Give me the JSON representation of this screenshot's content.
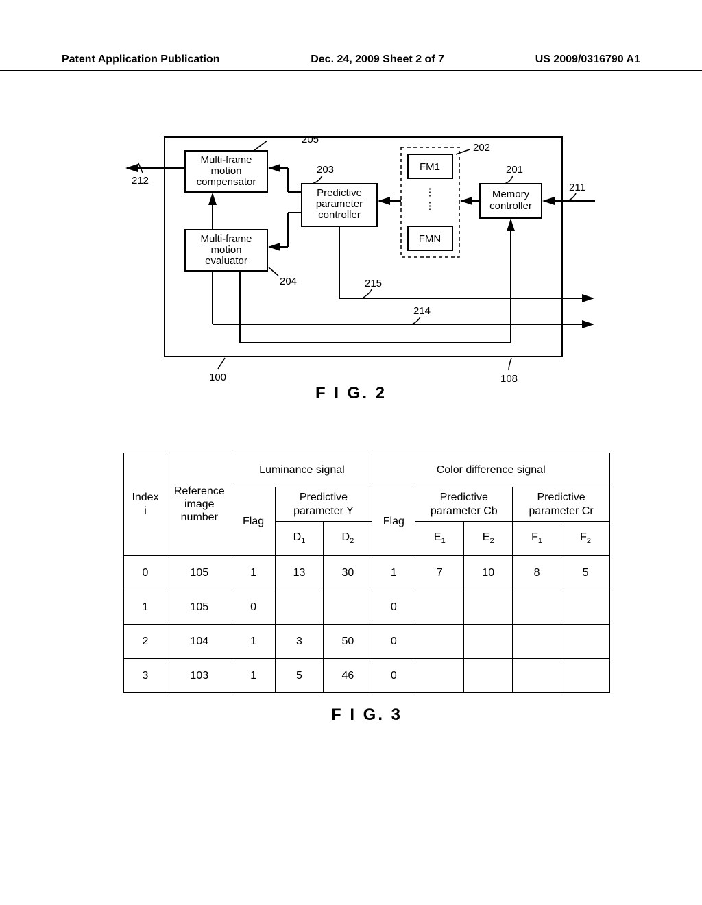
{
  "header": {
    "left": "Patent Application Publication",
    "center": "Dec. 24, 2009  Sheet 2 of 7",
    "right": "US 2009/0316790 A1"
  },
  "fig2": {
    "caption": "F I G. 2",
    "blocks": {
      "compensator": "Multi-frame\nmotion\ncompensator",
      "evaluator": "Multi-frame\nmotion\nevaluator",
      "ppc": "Predictive\nparameter\ncontroller",
      "fm1": "FM1",
      "fmn": "FMN",
      "memctrl": "Memory\ncontroller"
    },
    "labels": {
      "l205": "205",
      "l212": "212",
      "l204": "204",
      "l203": "203",
      "l202": "202",
      "l201": "201",
      "l211": "211",
      "l215": "215",
      "l214": "214",
      "l100": "100",
      "l108": "108"
    }
  },
  "fig3": {
    "caption": "F I G. 3",
    "headers": {
      "index": "Index\ni",
      "refimg": "Reference\nimage\nnumber",
      "lum": "Luminance signal",
      "color": "Color difference signal",
      "flag": "Flag",
      "ppy": "Predictive\nparameter Y",
      "ppcb": "Predictive\nparameter Cb",
      "ppcr": "Predictive\nparameter Cr",
      "d1": "D",
      "d2": "D",
      "e1": "E",
      "e2": "E",
      "f1": "F",
      "f2": "F"
    },
    "rows": [
      {
        "idx": "0",
        "ref": "105",
        "flagY": "1",
        "d1": "13",
        "d2": "30",
        "flagC": "1",
        "e1": "7",
        "e2": "10",
        "f1": "8",
        "f2": "5"
      },
      {
        "idx": "1",
        "ref": "105",
        "flagY": "0",
        "d1": "",
        "d2": "",
        "flagC": "0",
        "e1": "",
        "e2": "",
        "f1": "",
        "f2": ""
      },
      {
        "idx": "2",
        "ref": "104",
        "flagY": "1",
        "d1": "3",
        "d2": "50",
        "flagC": "0",
        "e1": "",
        "e2": "",
        "f1": "",
        "f2": ""
      },
      {
        "idx": "3",
        "ref": "103",
        "flagY": "1",
        "d1": "5",
        "d2": "46",
        "flagC": "0",
        "e1": "",
        "e2": "",
        "f1": "",
        "f2": ""
      }
    ]
  }
}
